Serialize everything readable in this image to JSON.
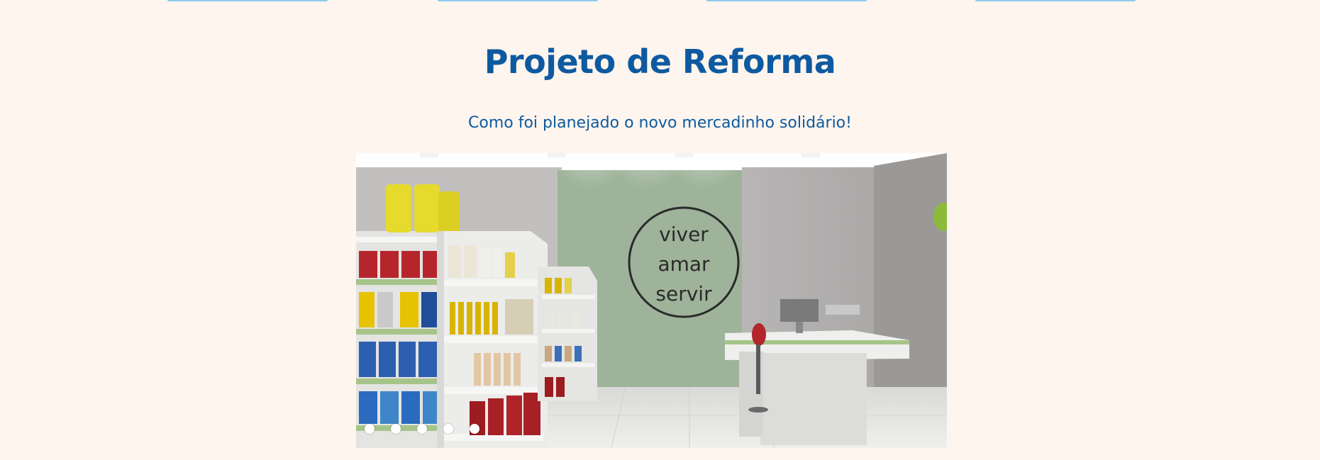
{
  "colors": {
    "background": "#fdf5ee",
    "title": "#0e5aa0",
    "subtitle": "#0e5aa0",
    "top_strip": "#8ecbee",
    "wall_accent": "#9eb39a",
    "dot": "#ffffff"
  },
  "section": {
    "title": "Projeto de Reforma",
    "subtitle": "Como foi planejado o novo mercadinho solidário!"
  },
  "carousel": {
    "slide_count": 5,
    "active_index": 0,
    "image_description_icon": "store-render-image",
    "wall_logo": [
      "viver",
      "amar",
      "servir"
    ]
  }
}
